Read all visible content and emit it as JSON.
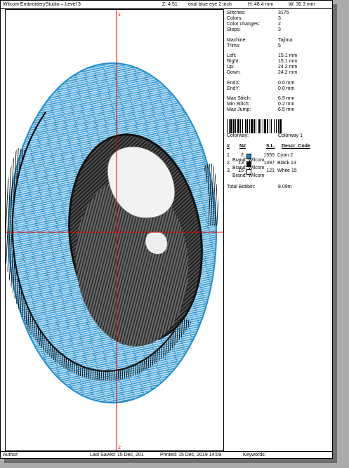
{
  "header": {
    "title": "Wilcom EmbroideryStudio – Level 3",
    "zoom": "Z: 4.51",
    "design_name": "oval blue eye 2 inch",
    "height": "H: 48.4 mm",
    "width": "W: 30.3 mm"
  },
  "stats": {
    "stitches": {
      "label": "Stitches:",
      "value": "3175"
    },
    "colors": {
      "label": "Colors:",
      "value": "3"
    },
    "color_changes": {
      "label": "Color changes:",
      "value": "2"
    },
    "stops": {
      "label": "Stops:",
      "value": "3"
    },
    "machine": {
      "label": "Machine:",
      "value": "Tajima"
    },
    "trims": {
      "label": "Trims:",
      "value": "5"
    },
    "left": {
      "label": "Left:",
      "value": "15.1 mm"
    },
    "right": {
      "label": "Right:",
      "value": "15.1 mm"
    },
    "up": {
      "label": "Up:",
      "value": "24.2 mm"
    },
    "down": {
      "label": "Down:",
      "value": "24.2 mm"
    },
    "endx": {
      "label": "EndX:",
      "value": "0.0 mm"
    },
    "endy": {
      "label": "EndY:",
      "value": "0.0 mm"
    },
    "max_stitch": {
      "label": "Max Stitch:",
      "value": "6.9 mm"
    },
    "min_stitch": {
      "label": "Min Stitch:",
      "value": "0.2 mm"
    },
    "max_jump": {
      "label": "Max Jump:",
      "value": "6.5 mm"
    }
  },
  "colorway": {
    "label": "Colorway:",
    "value": "Colorway 1"
  },
  "table": {
    "headers": {
      "num": "#",
      "n": "N#",
      "sl": "S.L.",
      "desc": "Descr_Code"
    },
    "rows": [
      {
        "index": "1.",
        "n": "2",
        "color": "#1e7fc4",
        "sl": "1555",
        "desc": "Cyan 2",
        "brand": "Brand: Wilcom"
      },
      {
        "index": "2.",
        "n": "13",
        "color": "#111111",
        "sl": "1497",
        "desc": "Black 13",
        "brand": "Brand: Wilcom"
      },
      {
        "index": "3.",
        "n": "15",
        "color": "#ffffff",
        "sl": "121",
        "desc": "White 15",
        "brand": "Brand: Wilcom"
      }
    ],
    "total_label": "Total Bobbin:",
    "total_value": "8.09m"
  },
  "markers": {
    "top": "1",
    "bottom": "2"
  },
  "footer": {
    "author": "Author:",
    "last_saved": "Last Saved: 15 Dec, 201",
    "printed": "Printed: 15 Dec, 2019 14:09",
    "keywords": "Keywords:"
  },
  "colors": {
    "cyan": "#1e8fd0",
    "black": "#111111",
    "crosshair": "#e00000"
  }
}
